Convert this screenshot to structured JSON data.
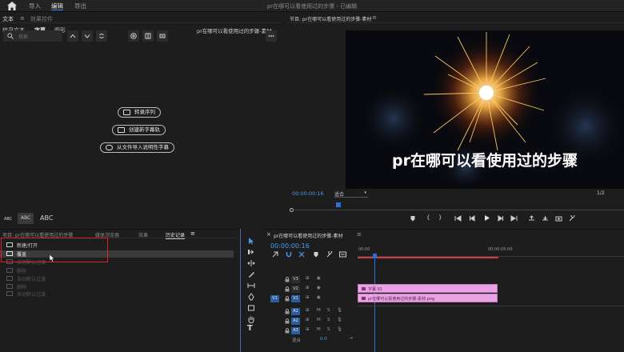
{
  "menubar": {
    "items": [
      "导入",
      "编辑",
      "导出"
    ],
    "active_index": 1,
    "doc_title": "pr在哪可以看使用过的步骤 - 已编辑"
  },
  "left_top_panel": {
    "tabs_row1": [
      "文本",
      "效果控件"
    ],
    "tabs_row2": [
      "转录文本",
      "字幕",
      "图形"
    ],
    "sequence_name": "pr在哪可以看使用过的步骤-素材",
    "search_placeholder": "搜索",
    "buttons": [
      "转录序列",
      "创建新字幕轨",
      "从文件导入说明性字幕"
    ],
    "caption_styles": [
      "ABC",
      "ABC",
      "ABC"
    ]
  },
  "bottom_left_panel": {
    "tabs": [
      "项目: pr在哪可以看使用过的步骤",
      "媒体浏览器",
      "效果",
      "历史记录"
    ],
    "active_tab_index": 3,
    "history": [
      {
        "label": "新建/打开",
        "state": "on"
      },
      {
        "label": "覆盖",
        "state": "selected"
      },
      {
        "label": "自动默认过渡",
        "state": "off"
      },
      {
        "label": "删除",
        "state": "off"
      },
      {
        "label": "自动默认过渡",
        "state": "off"
      },
      {
        "label": "删除",
        "state": "off"
      },
      {
        "label": "自动默认过渡",
        "state": "off"
      }
    ]
  },
  "program_monitor": {
    "title": "节目: pr在哪可以看使用过的步骤-素材",
    "timecode": "00:00:00:16",
    "fit": "适合",
    "resolution": "1/2",
    "caption": "pr在哪可以看使用过的步骤"
  },
  "timeline": {
    "sequence_tab": "pr在哪可以看使用过的步骤-素材",
    "timecode": "00:00:00:16",
    "ruler": [
      "00:00",
      "00:00:05:00"
    ],
    "video_tracks": [
      "V3",
      "V2",
      "V1"
    ],
    "audio_tracks": [
      "A1",
      "A2",
      "A3"
    ],
    "source_patch": "V1",
    "mute_label": "M",
    "solo_label": "S",
    "master_label": "混合",
    "master_value": "0.0",
    "clips": [
      {
        "track": "V2",
        "label": "字幕 01"
      },
      {
        "track": "V1",
        "label": "pr在哪可以看使用过的步骤-素材.png"
      }
    ]
  },
  "colors": {
    "accent_blue": "#2d8ceb",
    "clip_pink": "#e9a3e4",
    "highlight_red": "#e0222a",
    "playhead_blue": "#2b6fd6"
  }
}
